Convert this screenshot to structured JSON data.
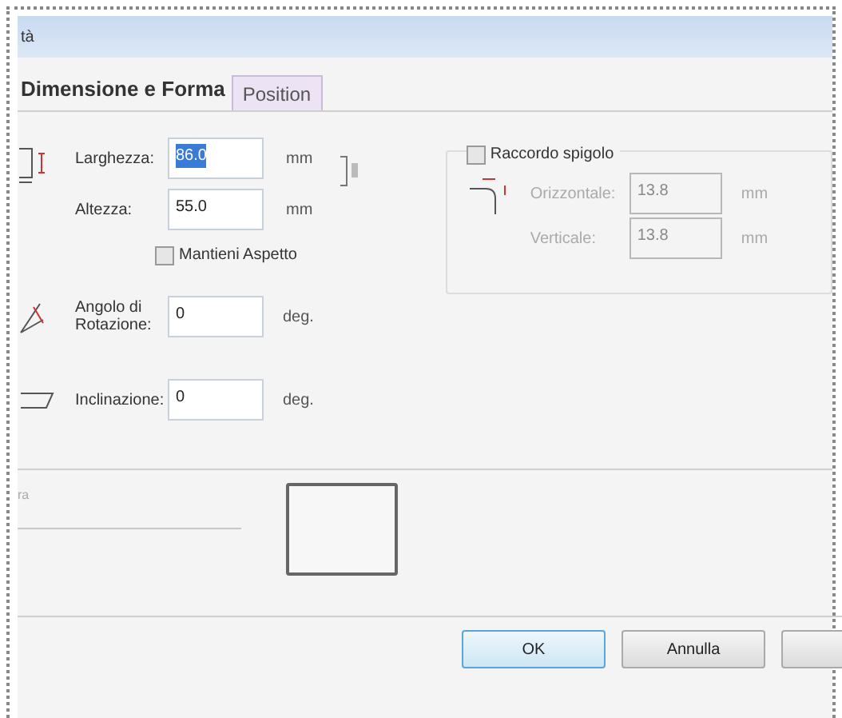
{
  "window": {
    "title": "tà"
  },
  "tabs": [
    {
      "label": "Dimensione e Forma",
      "selected": true
    },
    {
      "label": "Position",
      "selected": false
    }
  ],
  "size_fields": [
    {
      "label": "Larghezza:",
      "value": "86.0",
      "unit": "mm",
      "selected": true
    },
    {
      "label": "Altezza:",
      "value": "55.0",
      "unit": "mm",
      "selected": false
    }
  ],
  "keep_aspect": {
    "label": "Mantieni Aspetto",
    "checked": false
  },
  "corner": {
    "label": "Raccordo spigolo",
    "checked": false,
    "disabled": true,
    "fields": [
      {
        "label": "Orizzontale:",
        "value": "13.8",
        "unit": "mm"
      },
      {
        "label": "Verticale:",
        "value": "13.8",
        "unit": "mm"
      }
    ]
  },
  "rotation": {
    "label": "Angolo di Rotazione:",
    "value": "0",
    "unit": "deg."
  },
  "slant": {
    "label": "Inclinazione:",
    "value": "0",
    "unit": "deg."
  },
  "preview": {
    "label": "ra"
  },
  "buttons": [
    {
      "label": "OK",
      "default": true
    },
    {
      "label": "Annulla",
      "default": false
    }
  ]
}
